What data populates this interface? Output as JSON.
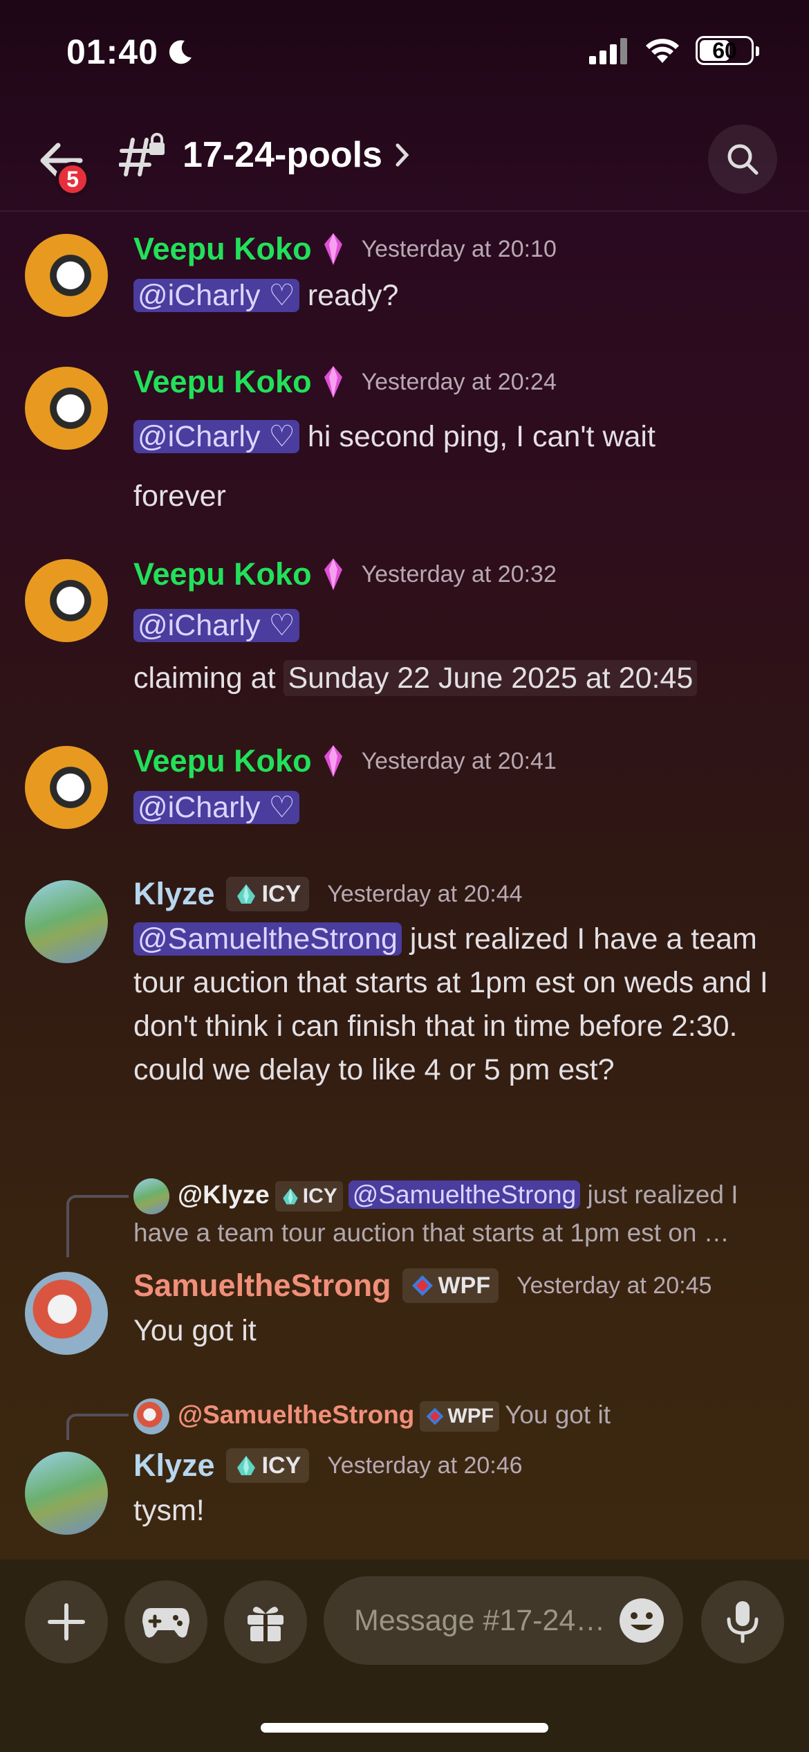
{
  "status_bar": {
    "time": "01:40",
    "battery": "60",
    "icons": [
      "moon-icon",
      "signal-icon",
      "wifi-icon",
      "battery-icon"
    ]
  },
  "header": {
    "back_badge": "5",
    "channel_name": "17-24-pools",
    "icons": [
      "back-arrow-icon",
      "locked-channel-icon",
      "chevron-right-icon",
      "search-icon"
    ]
  },
  "messages": [
    {
      "author": "Veepu Koko",
      "timestamp": "Yesterday at 20:10",
      "mention": "@iCharly ♡",
      "text": " ready?"
    },
    {
      "author": "Veepu Koko",
      "timestamp": "Yesterday at 20:24",
      "mention": "@iCharly ♡",
      "text": " hi second ping, I can't wait forever"
    },
    {
      "author": "Veepu Koko",
      "timestamp": "Yesterday at 20:32",
      "mention": "@iCharly ♡",
      "text_prefix": "claiming at ",
      "text_timestamp": "Sunday 22 June 2025 at 20:45"
    },
    {
      "author": "Veepu Koko",
      "timestamp": "Yesterday at 20:41",
      "mention": "@iCharly ♡"
    },
    {
      "author": "Klyze",
      "tag": "ICY",
      "timestamp": "Yesterday at 20:44",
      "mention": "@SamueltheStrong",
      "text": " just realized I have a team tour auction that starts at 1pm est on weds and I don't think i can finish that in time before 2:30. could we delay to like 4 or 5 pm est?"
    },
    {
      "reply_to": {
        "author": "@Klyze",
        "tag": "ICY",
        "mention": "@SamueltheStrong",
        "text": " just realized I have a team tour auction that starts at 1pm est on …"
      },
      "author": "SamueltheStrong",
      "tag": "WPF",
      "timestamp": "Yesterday at 20:45",
      "text": "You got it"
    },
    {
      "reply_to": {
        "author": "@SamueltheStrong",
        "tag": "WPF",
        "text": "You got it"
      },
      "author": "Klyze",
      "tag": "ICY",
      "timestamp": "Yesterday at 20:46",
      "text": "tysm!"
    }
  ],
  "composer": {
    "placeholder": "Message #17-24…",
    "icons": [
      "plus-icon",
      "gamepad-icon",
      "gift-icon",
      "emoji-icon",
      "microphone-icon"
    ]
  },
  "colors": {
    "mention_bg": "#4a3d9e",
    "veepu_name": "#22e05a",
    "klyze_name": "#b6d7f0",
    "samuel_name": "#f08f7a",
    "badge": "#e5303c"
  }
}
